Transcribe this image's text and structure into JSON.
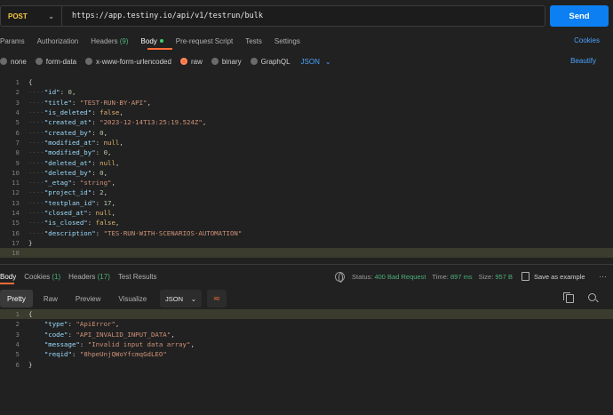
{
  "request": {
    "method": "POST",
    "url": "https://app.testiny.io/api/v1/testrun/bulk",
    "send_label": "Send"
  },
  "tabs": [
    {
      "label": "Params"
    },
    {
      "label": "Authorization"
    },
    {
      "label": "Headers",
      "count": "(9)"
    },
    {
      "label": "Body"
    },
    {
      "label": "Pre-request Script"
    },
    {
      "label": "Tests"
    },
    {
      "label": "Settings"
    }
  ],
  "cookies_label": "Cookies",
  "body_types": [
    {
      "label": "none"
    },
    {
      "label": "form-data"
    },
    {
      "label": "x-www-form-urlencoded"
    },
    {
      "label": "raw"
    },
    {
      "label": "binary"
    },
    {
      "label": "GraphQL"
    }
  ],
  "body_format": "JSON",
  "beautify_label": "Beautify",
  "request_body_lines": [
    {
      "n": "1",
      "t": "{"
    },
    {
      "n": "2",
      "key": "\"id\"",
      "val": "0",
      "kind": "n",
      "comma": true
    },
    {
      "n": "3",
      "key": "\"title\"",
      "val": "\"TEST·RUN·BY·API\"",
      "kind": "s",
      "comma": true
    },
    {
      "n": "4",
      "key": "\"is_deleted\"",
      "val": "false",
      "kind": "b",
      "comma": true
    },
    {
      "n": "5",
      "key": "\"created_at\"",
      "val": "\"2023-12-14T13:25:19.524Z\"",
      "kind": "s",
      "comma": true
    },
    {
      "n": "6",
      "key": "\"created_by\"",
      "val": "0",
      "kind": "n",
      "comma": true
    },
    {
      "n": "7",
      "key": "\"modified_at\"",
      "val": "null",
      "kind": "b",
      "comma": true
    },
    {
      "n": "8",
      "key": "\"modified_by\"",
      "val": "0",
      "kind": "n",
      "comma": true
    },
    {
      "n": "9",
      "key": "\"deleted_at\"",
      "val": "null",
      "kind": "b",
      "comma": true
    },
    {
      "n": "10",
      "key": "\"deleted_by\"",
      "val": "0",
      "kind": "n",
      "comma": true
    },
    {
      "n": "11",
      "key": "\"_etag\"",
      "val": "\"string\"",
      "kind": "s",
      "comma": true
    },
    {
      "n": "12",
      "key": "\"project_id\"",
      "val": "2",
      "kind": "n",
      "comma": true
    },
    {
      "n": "13",
      "key": "\"testplan_id\"",
      "val": "17",
      "kind": "n",
      "comma": true
    },
    {
      "n": "14",
      "key": "\"closed_at\"",
      "val": "null",
      "kind": "b",
      "comma": true
    },
    {
      "n": "15",
      "key": "\"is_closed\"",
      "val": "false",
      "kind": "b",
      "comma": true
    },
    {
      "n": "16",
      "key": "\"description\"",
      "val": "\"TES·RUN·WITH·SCENARIOS·AUTOMATION\"",
      "kind": "s",
      "comma": false
    },
    {
      "n": "17",
      "t": "}"
    },
    {
      "n": "18",
      "t": ""
    }
  ],
  "response_tabs": [
    {
      "label": "Body"
    },
    {
      "label": "Cookies",
      "count": "(1)"
    },
    {
      "label": "Headers",
      "count": "(17)"
    },
    {
      "label": "Test Results"
    }
  ],
  "response_status": {
    "status_label": "Status:",
    "status_value": "400 Bad Request",
    "time_label": "Time:",
    "time_value": "897 ms",
    "size_label": "Size:",
    "size_value": "957 B",
    "save_label": "Save as example",
    "more": "···"
  },
  "response_views": [
    {
      "label": "Pretty"
    },
    {
      "label": "Raw"
    },
    {
      "label": "Preview"
    },
    {
      "label": "Visualize"
    }
  ],
  "response_format": "JSON",
  "response_body_lines": [
    {
      "n": "1",
      "t": "{"
    },
    {
      "n": "2",
      "key": "\"type\"",
      "val": "\"ApiError\"",
      "kind": "s",
      "comma": true
    },
    {
      "n": "3",
      "key": "\"code\"",
      "val": "\"API_INVALID_INPUT_DATA\"",
      "kind": "s",
      "comma": true
    },
    {
      "n": "4",
      "key": "\"message\"",
      "val": "\"Invalid input data array\"",
      "kind": "s",
      "comma": true
    },
    {
      "n": "5",
      "key": "\"reqid\"",
      "val": "\"8hpeUnjQWoYfcmqGdLEO\"",
      "kind": "s",
      "comma": false
    },
    {
      "n": "6",
      "t": "}"
    }
  ],
  "colors": {
    "accent": "#ff6c37",
    "send": "#0c7ff2",
    "link": "#4aa3ff",
    "status_error": "#4caf7a",
    "method": "#f5c842"
  }
}
